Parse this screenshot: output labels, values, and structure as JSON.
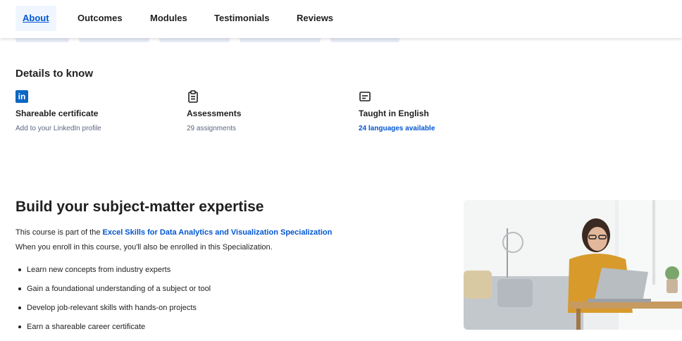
{
  "tabs": [
    {
      "label": "About",
      "active": true
    },
    {
      "label": "Outcomes"
    },
    {
      "label": "Modules"
    },
    {
      "label": "Testimonials"
    },
    {
      "label": "Reviews"
    }
  ],
  "details": {
    "heading": "Details to know",
    "items": [
      {
        "icon": "linkedin-icon",
        "title": "Shareable certificate",
        "subtitle": "Add to your LinkedIn profile"
      },
      {
        "icon": "clipboard-icon",
        "title": "Assessments",
        "subtitle": "29 assignments"
      },
      {
        "icon": "captions-icon",
        "title": "Taught in English",
        "subtitle": "24 languages available"
      }
    ]
  },
  "expertise": {
    "heading": "Build your subject-matter expertise",
    "line1_prefix": "This course is part of the ",
    "line1_link": "Excel Skills for Data Analytics and Visualization Specialization",
    "line2": "When you enroll in this course, you'll also be enrolled in this Specialization.",
    "bullets": [
      "Learn new concepts from industry experts",
      "Gain a foundational understanding of a subject or tool",
      "Develop job-relevant skills with hands-on projects",
      "Earn a shareable career certificate"
    ]
  },
  "colors": {
    "accent": "#0056d2",
    "linkedin": "#0a66c2"
  }
}
